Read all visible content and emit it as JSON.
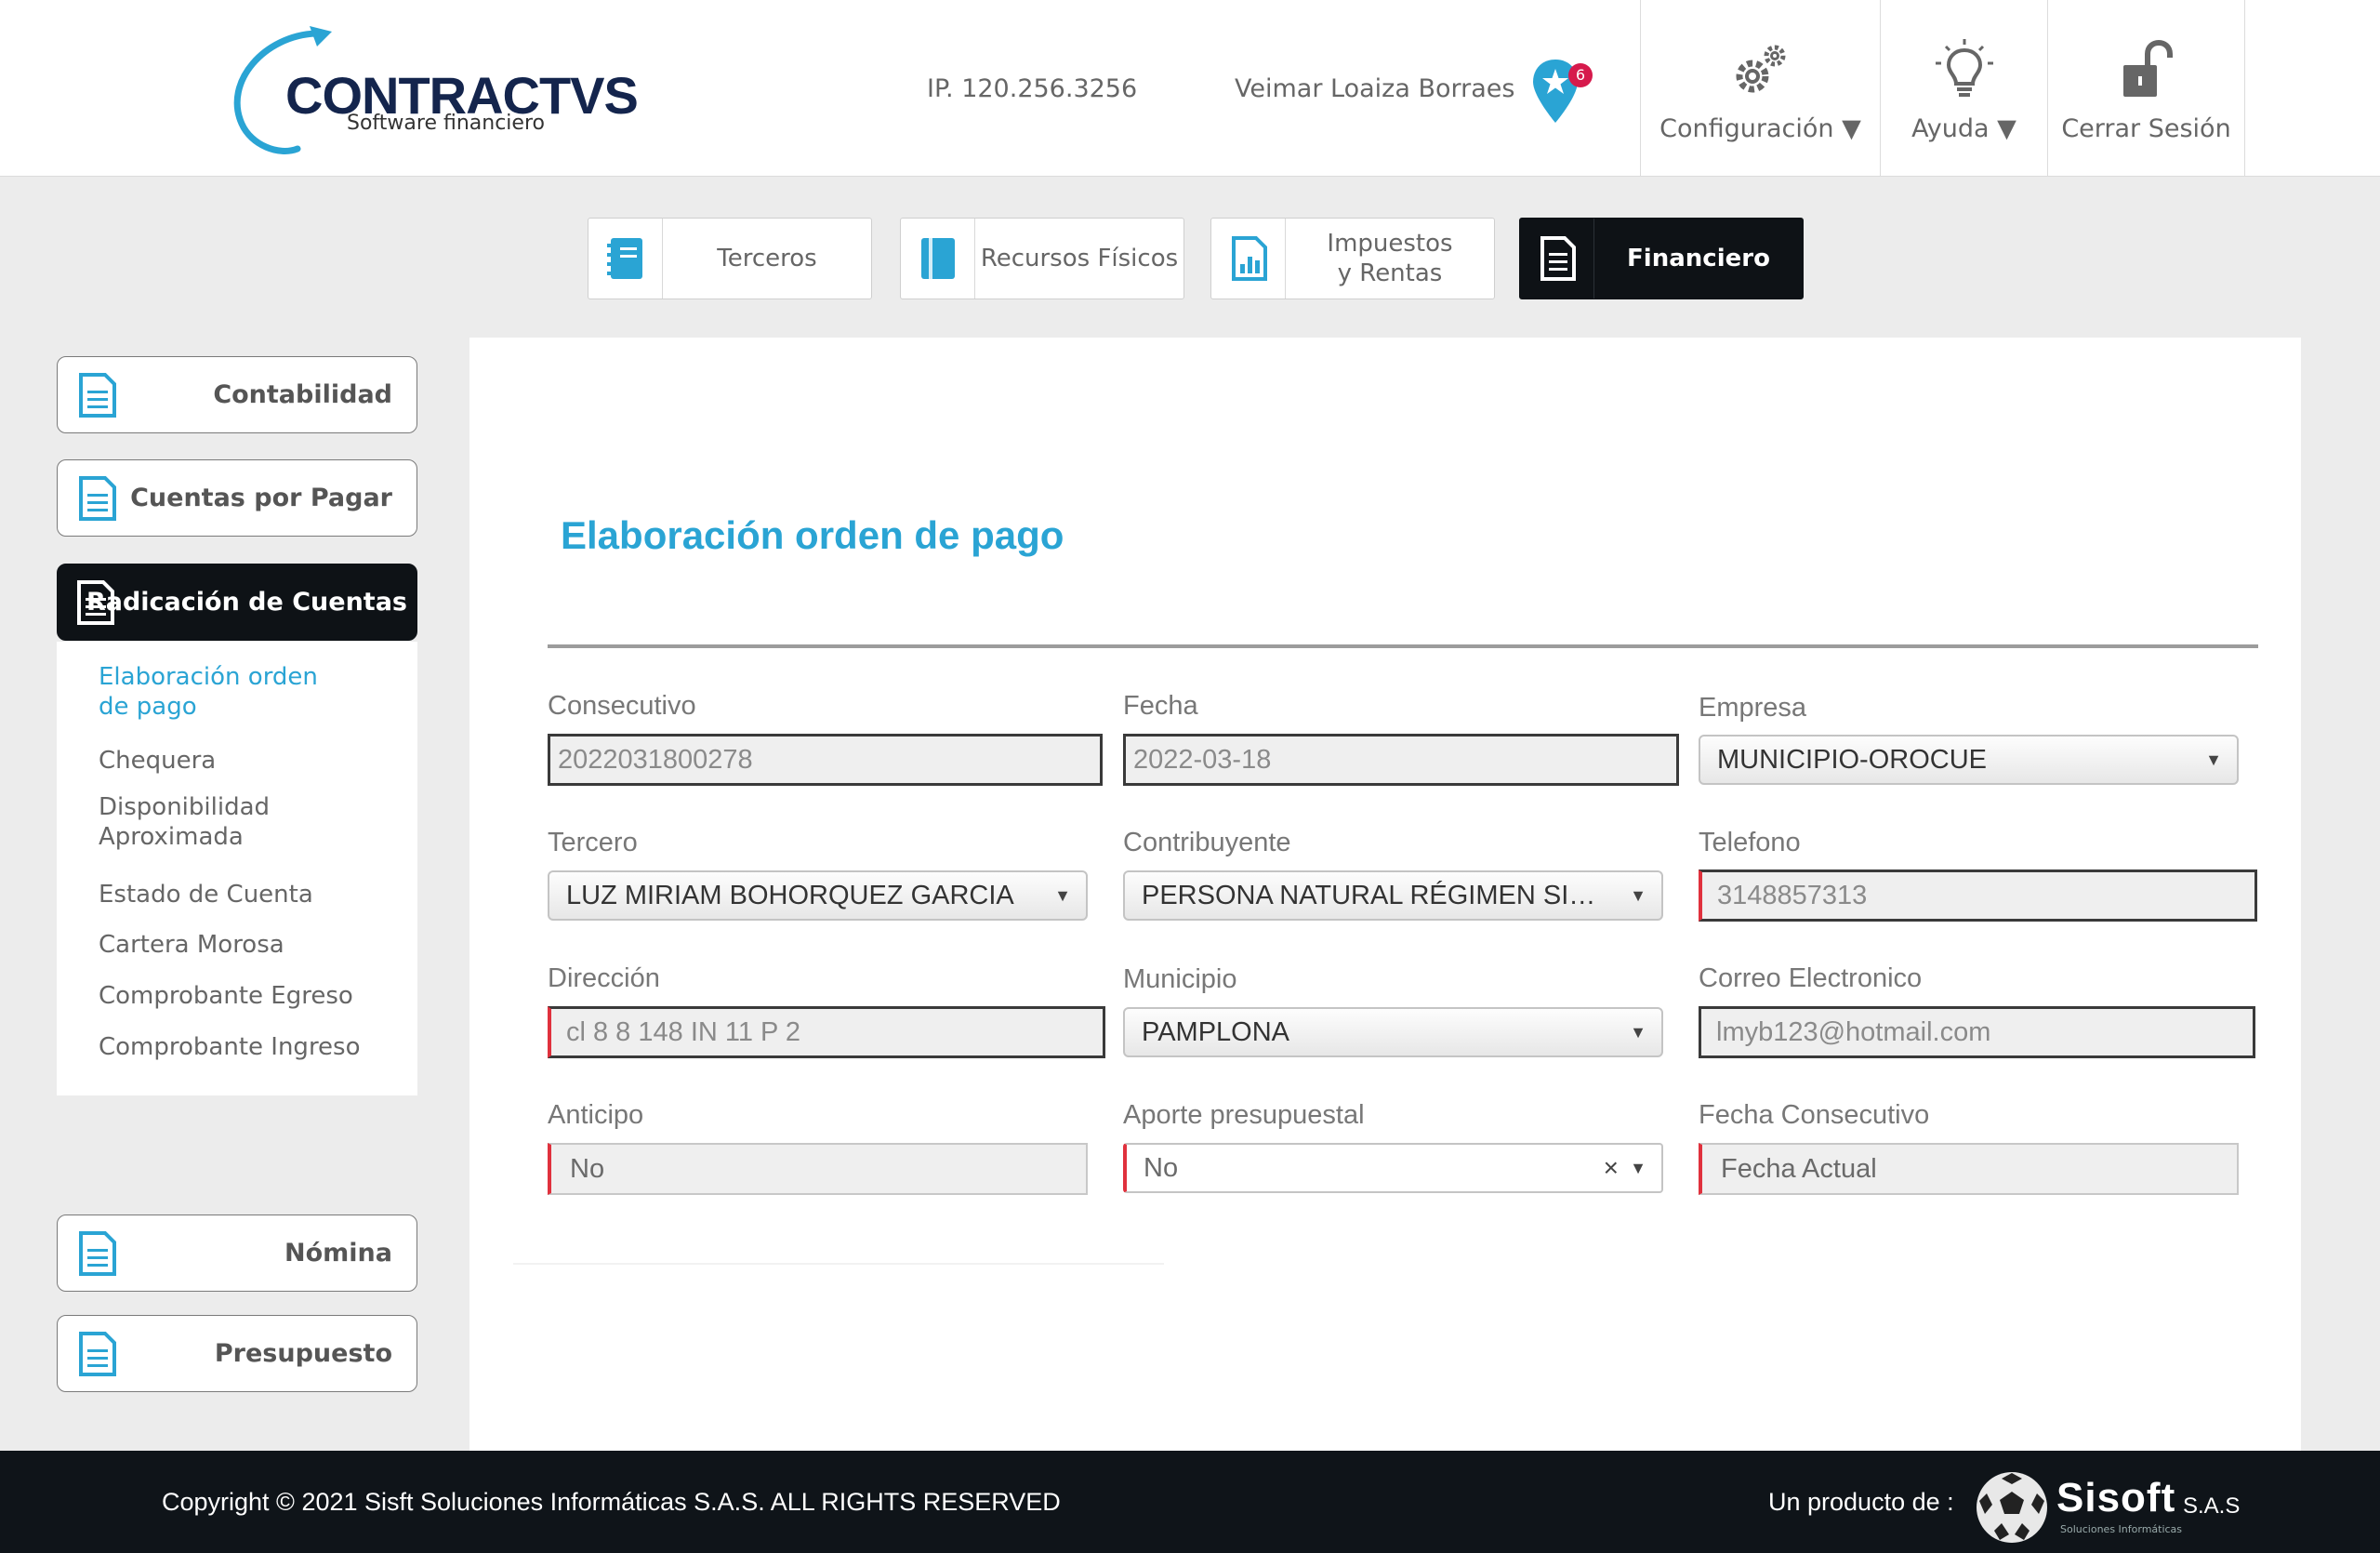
{
  "header": {
    "logo_name": "CONTRACTVS",
    "logo_subtitle": "Software financiero",
    "ip": "IP. 120.256.3256",
    "user": "Veimar Loaiza Borraes",
    "notification_count": "6",
    "buttons": [
      {
        "label": "Configuración ▼",
        "icon": "gears-icon"
      },
      {
        "label": "Ayuda ▼",
        "icon": "lightbulb-icon"
      },
      {
        "label": "Cerrar Sesión",
        "icon": "unlock-icon"
      }
    ]
  },
  "modules": [
    {
      "label": "Terceros",
      "icon": "notebook-icon",
      "active": false
    },
    {
      "label": "Recursos Físicos",
      "icon": "book-icon",
      "active": false
    },
    {
      "label": "Impuestos\ny Rentas",
      "icon": "report-chart-icon",
      "active": false
    },
    {
      "label": "Financiero",
      "icon": "document-icon",
      "active": true
    }
  ],
  "sidebar": {
    "sections": [
      {
        "label": "Contabilidad"
      },
      {
        "label": "Cuentas por Pagar"
      },
      {
        "label": "Radicación de Cuentas"
      },
      {
        "label": "Nómina"
      },
      {
        "label": "Presupuesto"
      }
    ],
    "submenu": [
      {
        "label": "Elaboración orden\nde pago",
        "active": true
      },
      {
        "label": "Chequera"
      },
      {
        "label": "Disponibilidad\nAproximada"
      },
      {
        "label": "Estado de Cuenta"
      },
      {
        "label": "Cartera Morosa"
      },
      {
        "label": "Comprobante Egreso"
      },
      {
        "label": "Comprobante Ingreso"
      }
    ]
  },
  "form": {
    "title": "Elaboración orden de pago",
    "consecutivo": {
      "label": "Consecutivo",
      "value": "2022031800278"
    },
    "fecha": {
      "label": "Fecha",
      "value": "2022-03-18"
    },
    "empresa": {
      "label": "Empresa",
      "value": "MUNICIPIO-OROCUE"
    },
    "tercero": {
      "label": "Tercero",
      "value": "LUZ MIRIAM BOHORQUEZ GARCIA"
    },
    "contribuyente": {
      "label": "Contribuyente",
      "value": "PERSONA NATURAL RÉGIMEN SI…"
    },
    "telefono": {
      "label": "Telefono",
      "value": "3148857313"
    },
    "direccion": {
      "label": "Dirección",
      "value": "cl 8 8 148 IN 11 P 2"
    },
    "municipio": {
      "label": "Municipio",
      "value": "PAMPLONA"
    },
    "correo": {
      "label": "Correo Electronico",
      "value": "lmyb123@hotmail.com"
    },
    "anticipo": {
      "label": "Anticipo",
      "value": "No"
    },
    "aporte": {
      "label": "Aporte presupuestal",
      "value": "No"
    },
    "fecha_consecutivo": {
      "label": "Fecha Consecutivo",
      "value": "Fecha Actual"
    }
  },
  "footer": {
    "copyright": "Copyright © 2021 Sisft Soluciones Informáticas S.A.S. ALL RIGHTS RESERVED",
    "producto": "Un producto de :",
    "brand": "Sisoft",
    "brand_suffix": "S.A.S",
    "brand_sub": "Soluciones Informáticas"
  },
  "colors": {
    "accent": "#2aa4d4",
    "dark": "#0e1216",
    "required_marker": "#e0313d",
    "brand_navy": "#14254d",
    "badge": "#d61a4c"
  }
}
